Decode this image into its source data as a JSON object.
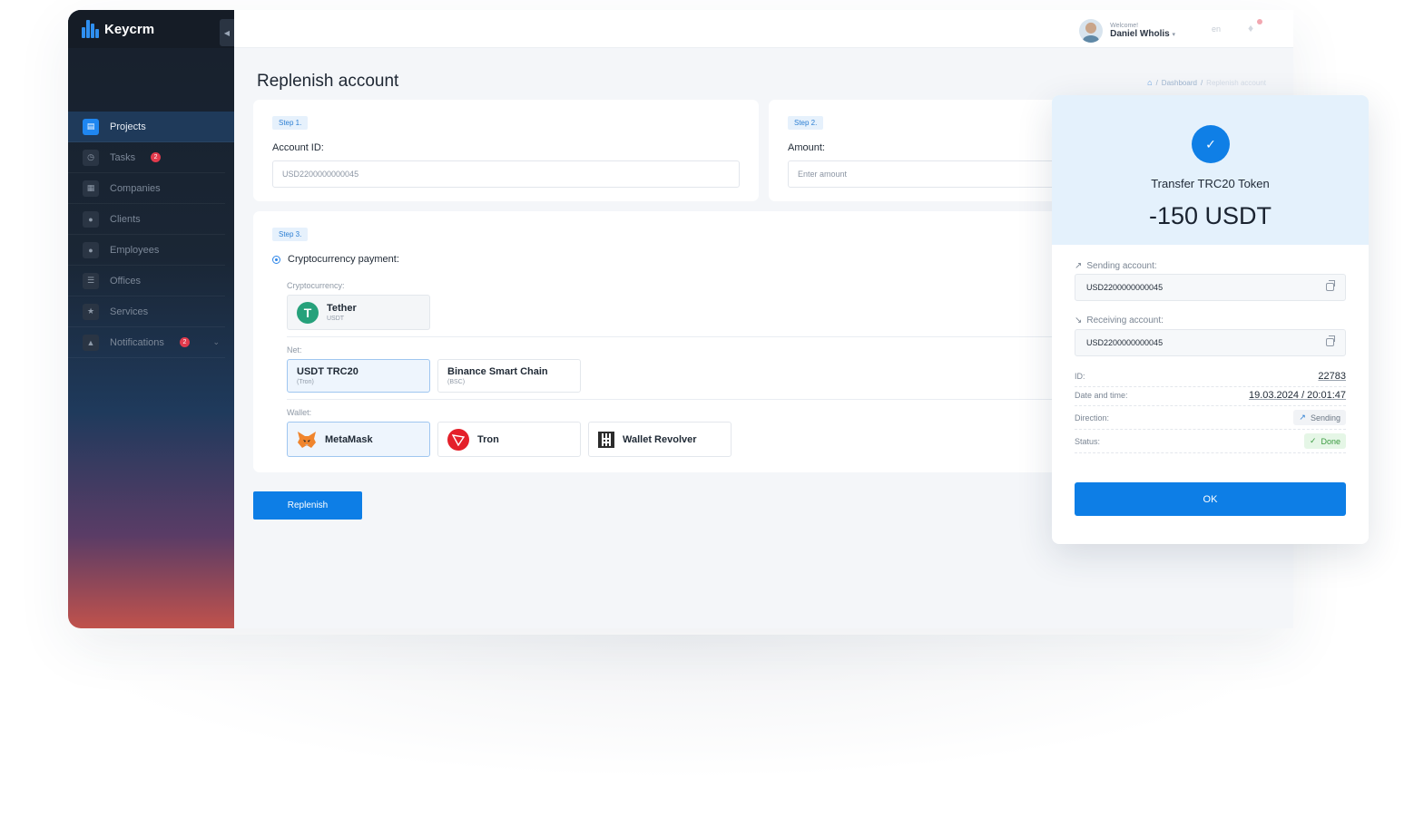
{
  "app": {
    "logo_text": "Keycrm"
  },
  "sidebar": {
    "items": [
      {
        "label": "Projects",
        "icon": "briefcase-icon",
        "active": true
      },
      {
        "label": "Tasks",
        "icon": "stopwatch-icon",
        "badge": "2"
      },
      {
        "label": "Companies",
        "icon": "building-icon"
      },
      {
        "label": "Clients",
        "icon": "group-icon"
      },
      {
        "label": "Employees",
        "icon": "person-icon"
      },
      {
        "label": "Offices",
        "icon": "bank-icon"
      },
      {
        "label": "Services",
        "icon": "star-icon"
      },
      {
        "label": "Notifications",
        "icon": "bell-icon",
        "badge": "2"
      }
    ]
  },
  "header": {
    "welcome": "Welcome!",
    "user_name": "Daniel Wholis",
    "language": "en"
  },
  "page": {
    "title": "Replenish account",
    "breadcrumb": {
      "dashboard": "Dashboard",
      "current": "Replenish account"
    }
  },
  "step1": {
    "tag": "Step 1.",
    "label": "Account ID:",
    "value": "USD2200000000045"
  },
  "step2": {
    "tag": "Step 2.",
    "label": "Amount:",
    "placeholder": "Enter amount"
  },
  "step3": {
    "tag": "Step 3.",
    "method_label": "Cryptocurrency payment:",
    "crypto_label": "Cryptocurrency:",
    "crypto": {
      "name": "Tether",
      "sub": "USDT"
    },
    "net_label": "Net:",
    "nets": [
      {
        "name": "USDT TRC20",
        "sub": "(Tron)"
      },
      {
        "name": "Binance Smart Chain",
        "sub": "(BSC)"
      }
    ],
    "wallet_label": "Wallet:",
    "wallets": [
      {
        "name": "MetaMask"
      },
      {
        "name": "Tron"
      },
      {
        "name": "Wallet Revolver"
      }
    ]
  },
  "replenish_button": "Replenish",
  "modal": {
    "title": "Transfer TRC20 Token",
    "amount": "-150 USDT",
    "sending_label": "Sending account:",
    "sending_value": "USD2200000000045",
    "receiving_label": "Receiving account:",
    "receiving_value": "USD2200000000045",
    "id_label": "ID:",
    "id_value": "22783",
    "datetime_label": "Date and time:",
    "datetime_value": "19.03.2024 / 20:01:47",
    "direction_label": "Direction:",
    "direction_value": "Sending",
    "status_label": "Status:",
    "status_value": "Done",
    "ok_button": "OK"
  },
  "colors": {
    "accent": "#0d7ee6",
    "badge": "#e23a4c",
    "tether": "#26a17b",
    "tron": "#e4202a",
    "done": "#3a9a3f"
  }
}
